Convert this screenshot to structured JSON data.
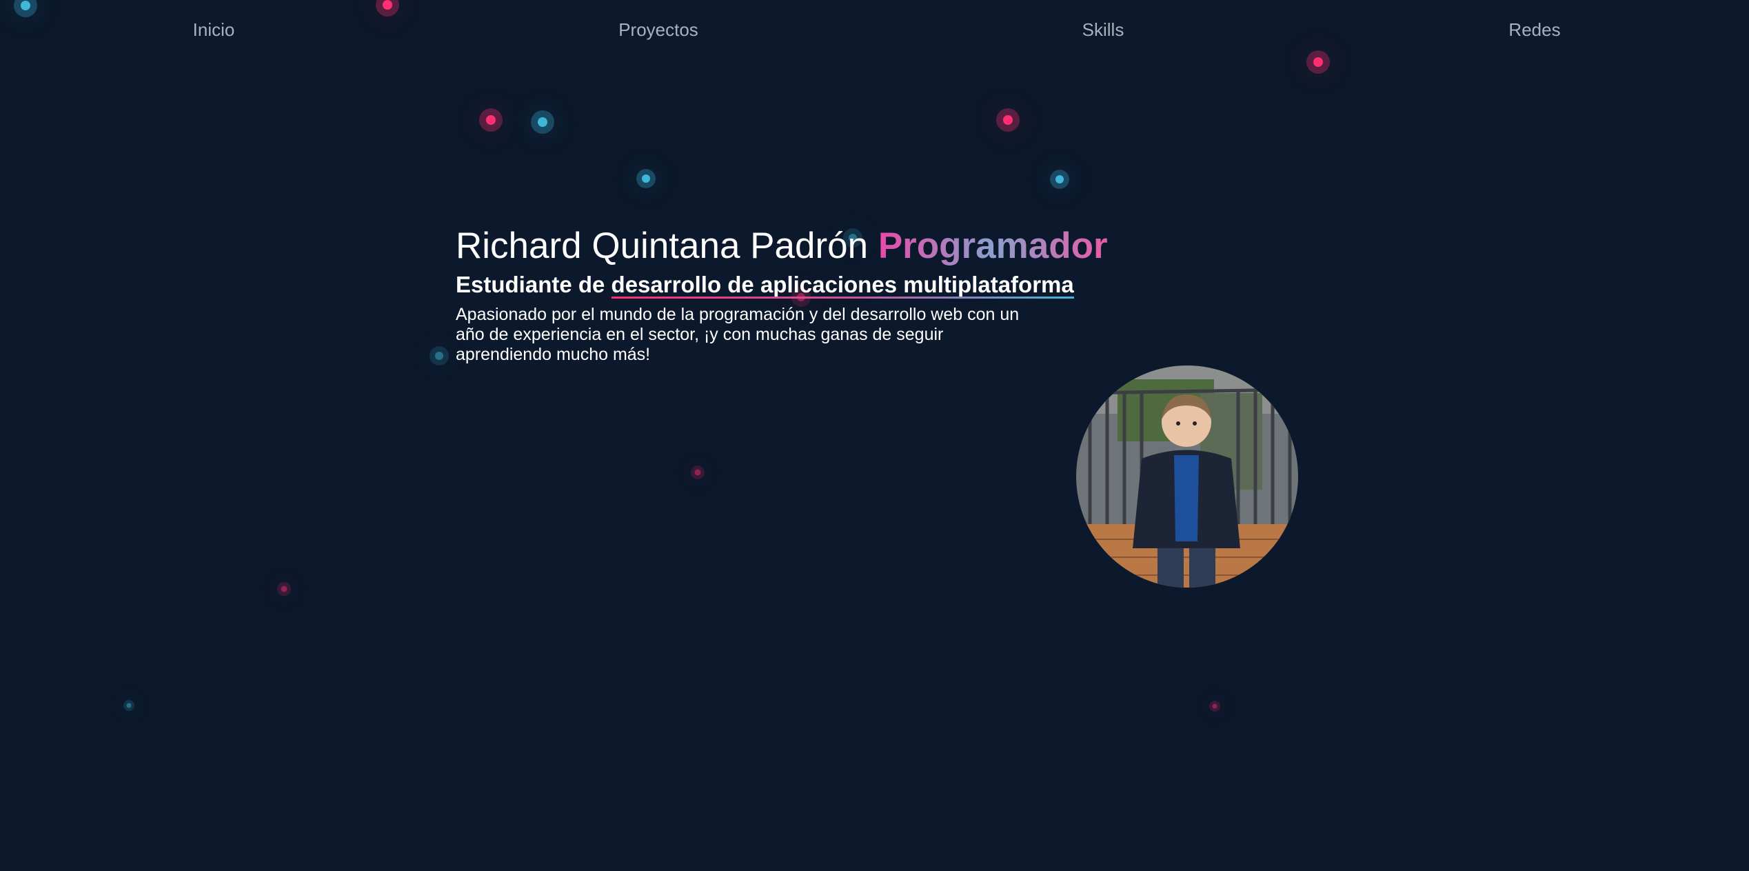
{
  "nav": {
    "items": [
      "Inicio",
      "Proyectos",
      "Skills",
      "Redes"
    ]
  },
  "hero": {
    "name": "Richard Quintana Padrón",
    "role": "Programador",
    "subtitle_prefix": "Estudiante de",
    "subtitle_highlight": "desarrollo de aplicaciones multiplataforma",
    "description": "Apasionado por el mundo de la programación y del desarrollo web con un año de experiencia en el sector, ¡y con muchas ganas de seguir aprendiendo mucho más!"
  },
  "avatar": {
    "alt": "avatar",
    "icon": "profile-photo"
  },
  "colors": {
    "background": "#0c182b",
    "accent_pink": "#ff2f72",
    "accent_blue": "#3fb7db",
    "nav_text": "#aab1bd"
  }
}
